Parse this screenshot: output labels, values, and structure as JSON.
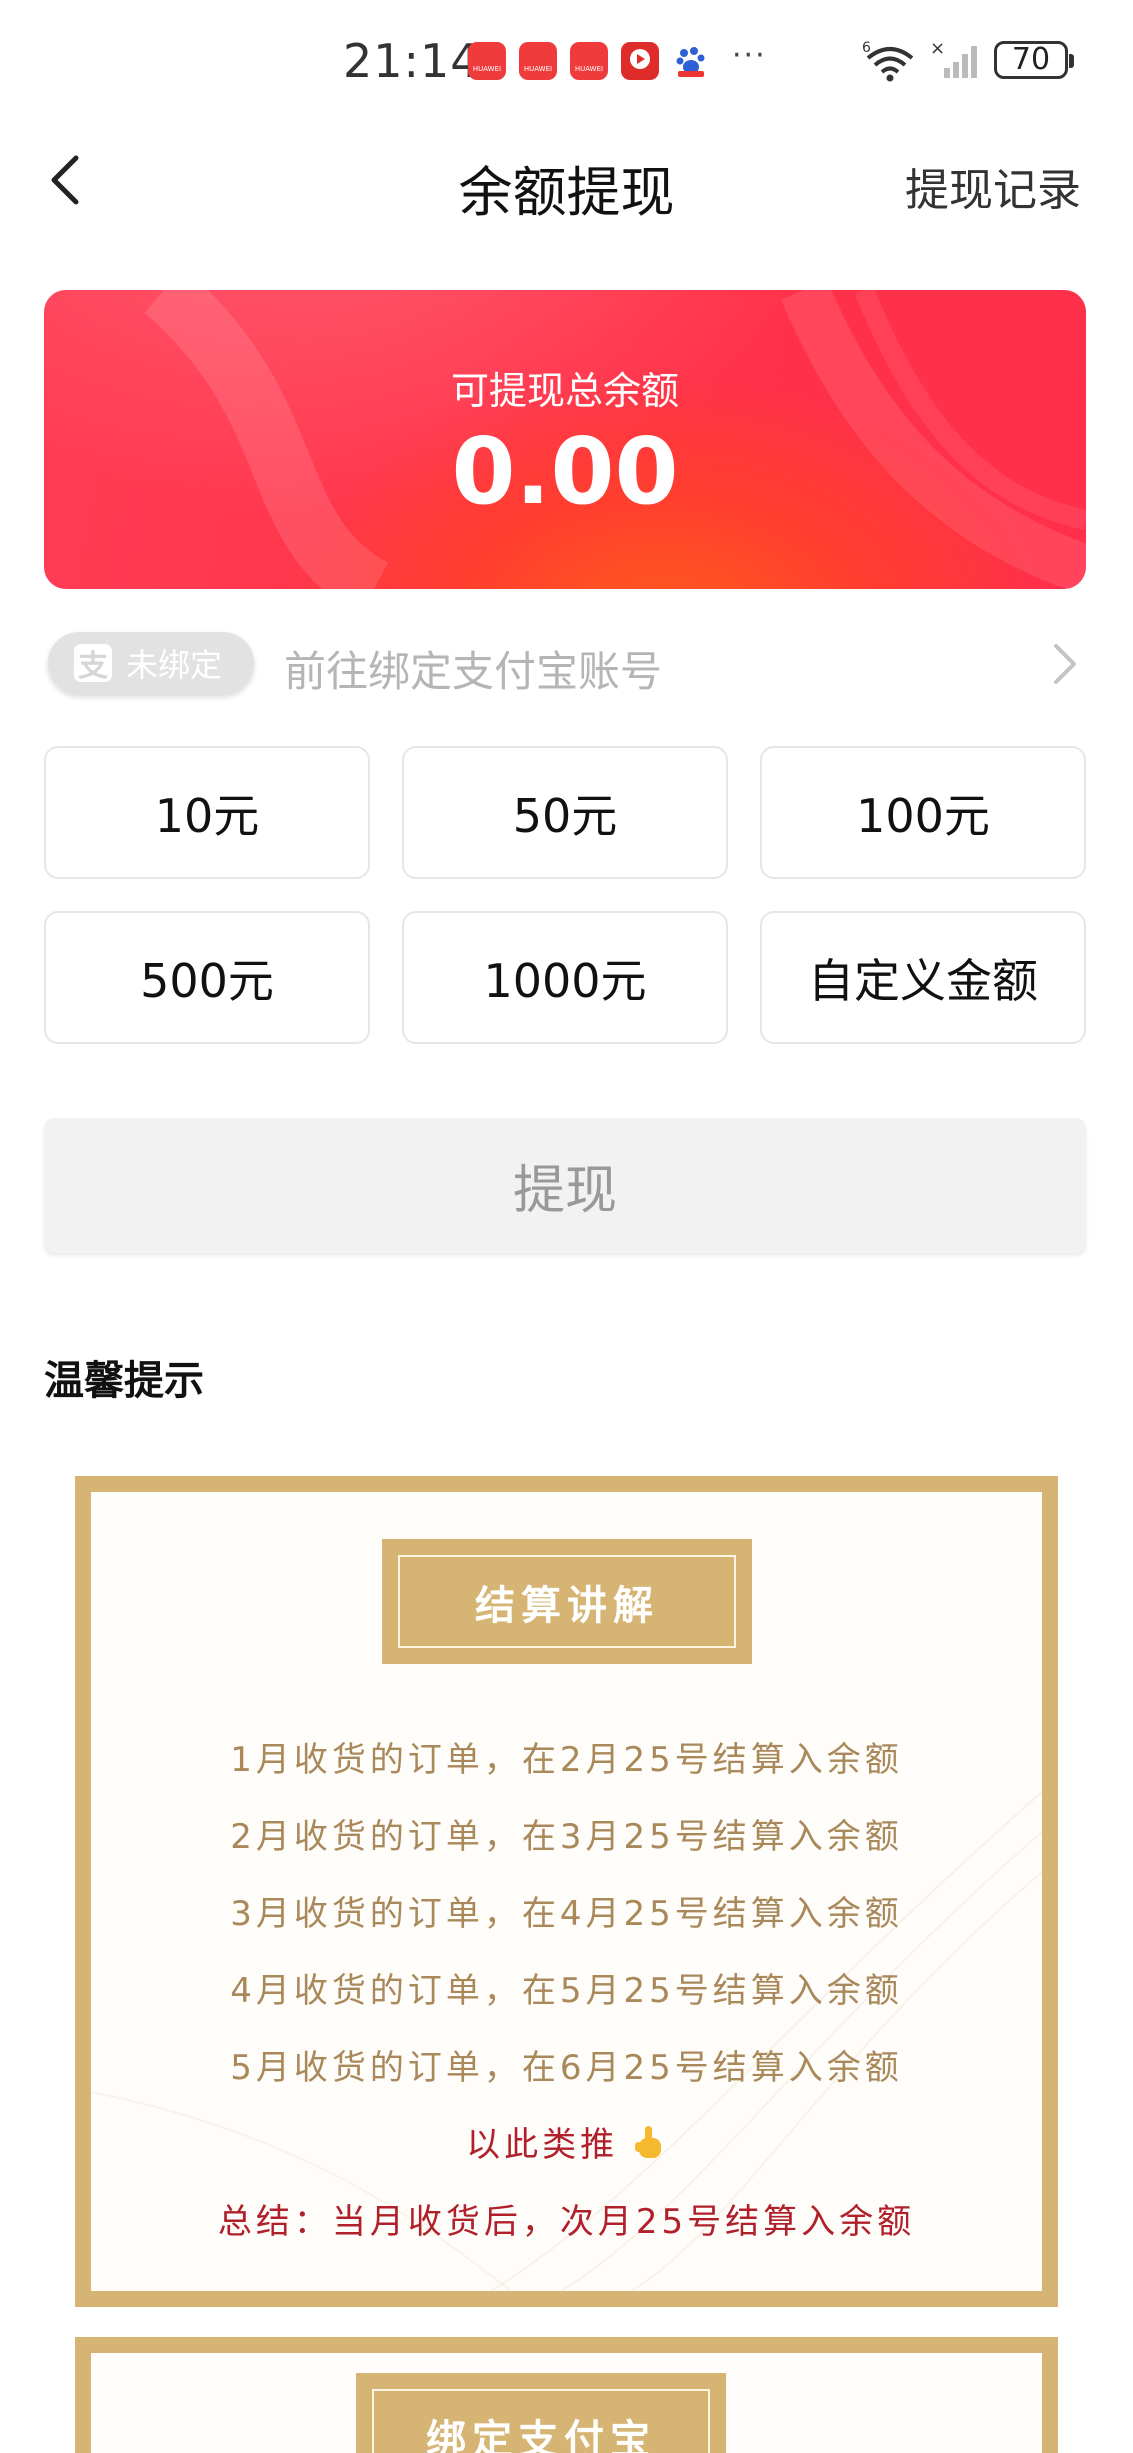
{
  "status_bar": {
    "time": "21:14",
    "apps": [
      "HUAWEI",
      "HUAWEI",
      "HUAWEI",
      "video-app",
      "baidu-app"
    ],
    "more": "···",
    "network": "6",
    "battery": "70"
  },
  "nav": {
    "title": "余额提现",
    "record_label": "提现记录"
  },
  "balance": {
    "label": "可提现总余额",
    "value": "0.00"
  },
  "alipay": {
    "badge_icon": "支",
    "badge_text": "未绑定",
    "prompt": "前往绑定支付宝账号"
  },
  "amounts": [
    "10元",
    "50元",
    "100元",
    "500元",
    "1000元",
    "自定义金额"
  ],
  "withdraw_label": "提现",
  "tips": {
    "title": "温馨提示",
    "card1": {
      "header": "结算讲解",
      "lines": [
        "1月收货的订单，在2月25号结算入余额",
        "2月收货的订单，在3月25号结算入余额",
        "3月收货的订单，在4月25号结算入余额",
        "4月收货的订单，在5月25号结算入余额",
        "5月收货的订单，在6月25号结算入余额"
      ],
      "tail": "以此类推",
      "summary": "总结：当月收货后，次月25号结算入余额"
    },
    "card2": {
      "header": "绑定支付宝"
    }
  },
  "colors": {
    "accent_red": "#ff3348",
    "gold": "#d6b574",
    "gold_text": "#a9885a",
    "summary_red": "#b0202a"
  }
}
